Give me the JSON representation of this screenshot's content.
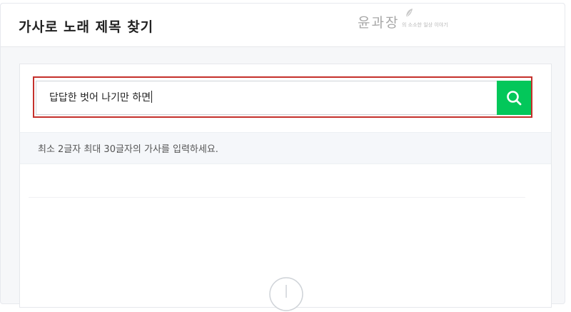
{
  "header": {
    "title": "가사로 노래 제목 찾기"
  },
  "watermark": {
    "brand": "윤과장",
    "tagline": "의 소소한 일상 이야기"
  },
  "search": {
    "value": "답답한 벗어 나기만 하면",
    "icon": "search-icon",
    "button_color": "#03c75a"
  },
  "hint": {
    "text": "최소 2글자 최대 30글자의 가사를 입력하세요."
  },
  "colors": {
    "accent": "#03c75a",
    "highlight": "#c4302b"
  }
}
